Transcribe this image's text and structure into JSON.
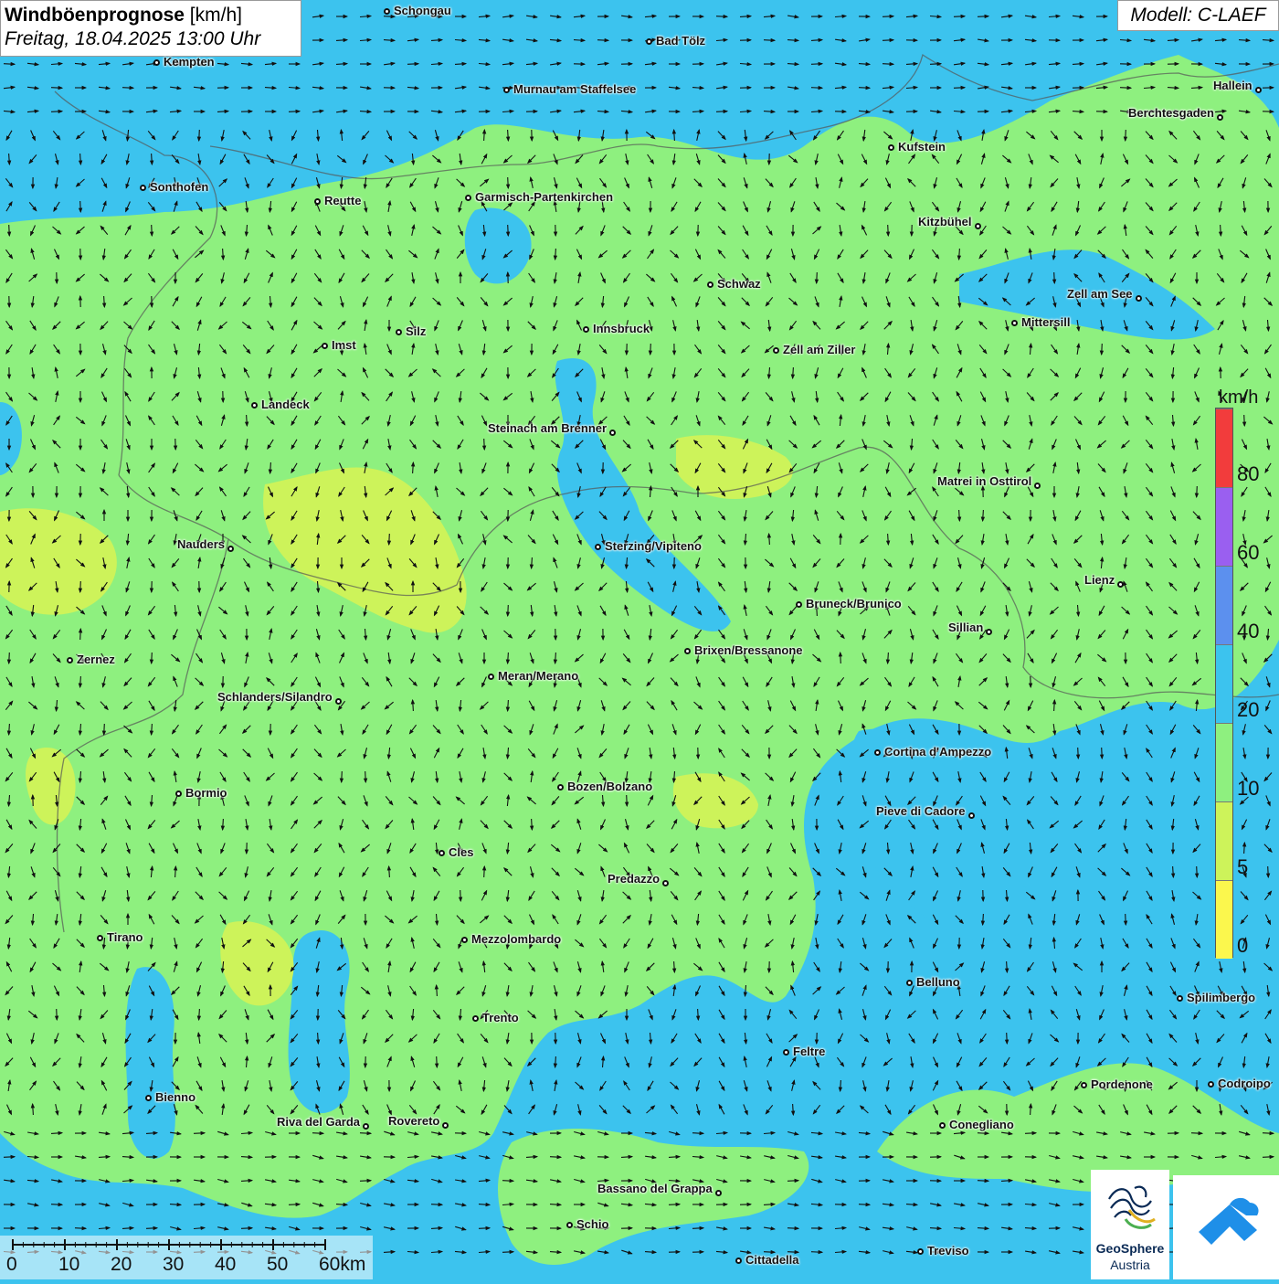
{
  "title": {
    "main_bold": "Windböenprognose",
    "main_unit": " [km/h]",
    "date": "Freitag, 18.04.2025 13:00 Uhr"
  },
  "model": "Modell: C-LAEF",
  "legend": {
    "unit": "km/h",
    "bins": [
      {
        "from": 0,
        "to": 5,
        "color": "#fbf74d"
      },
      {
        "from": 5,
        "to": 10,
        "color": "#cdf35a"
      },
      {
        "from": 10,
        "to": 20,
        "color": "#8ef07f"
      },
      {
        "from": 20,
        "to": 40,
        "color": "#3cc3ee"
      },
      {
        "from": 40,
        "to": 60,
        "color": "#5c90ee"
      },
      {
        "from": 60,
        "to": 80,
        "color": "#9a5ff0"
      },
      {
        "from": 80,
        "to": 100,
        "color": "#f23c3c"
      }
    ],
    "labels": [
      "0",
      "5",
      "10",
      "20",
      "40",
      "60",
      "80"
    ]
  },
  "scalebar": {
    "labels": [
      "0",
      "10",
      "20",
      "30",
      "40",
      "50",
      "60km"
    ]
  },
  "logos": {
    "geosphere_line1": "GeoSphere",
    "geosphere_line2": "Austria"
  },
  "cities": [
    {
      "name": "Schongau",
      "label_side": "right"
    },
    {
      "name": "Bad Tölz",
      "label_side": "right"
    },
    {
      "name": "Kempten",
      "label_side": "right"
    },
    {
      "name": "Murnau am Staffelsee",
      "label_side": "right"
    },
    {
      "name": "Hallein",
      "label_side": "left"
    },
    {
      "name": "Berchtesgaden",
      "label_side": "left"
    },
    {
      "name": "Kufstein",
      "label_side": "right"
    },
    {
      "name": "Sonthofen",
      "label_side": "right"
    },
    {
      "name": "Reutte",
      "label_side": "right"
    },
    {
      "name": "Garmisch-Partenkirchen",
      "label_side": "right"
    },
    {
      "name": "Kitzbühel",
      "label_side": "left"
    },
    {
      "name": "Schwaz",
      "label_side": "right"
    },
    {
      "name": "Zell am See",
      "label_side": "left"
    },
    {
      "name": "Mittersill",
      "label_side": "right"
    },
    {
      "name": "Innsbruck",
      "label_side": "right"
    },
    {
      "name": "Silz",
      "label_side": "right"
    },
    {
      "name": "Imst",
      "label_side": "right"
    },
    {
      "name": "Zell am Ziller",
      "label_side": "right"
    },
    {
      "name": "Landeck",
      "label_side": "right"
    },
    {
      "name": "Steinach am Brenner",
      "label_side": "left"
    },
    {
      "name": "Matrei in Osttirol",
      "label_side": "left"
    },
    {
      "name": "Nauders",
      "label_side": "left"
    },
    {
      "name": "Sterzing/Vipiteno",
      "label_side": "right"
    },
    {
      "name": "Lienz",
      "label_side": "left"
    },
    {
      "name": "Bruneck/Brunico",
      "label_side": "right"
    },
    {
      "name": "Sillian",
      "label_side": "left"
    },
    {
      "name": "Zernez",
      "label_side": "right"
    },
    {
      "name": "Brixen/Bressanone",
      "label_side": "right"
    },
    {
      "name": "Meran/Merano",
      "label_side": "right"
    },
    {
      "name": "Schlanders/Silandro",
      "label_side": "left"
    },
    {
      "name": "Cortina d'Ampezzo",
      "label_side": "right"
    },
    {
      "name": "Bormio",
      "label_side": "right"
    },
    {
      "name": "Bozen/Bolzano",
      "label_side": "right"
    },
    {
      "name": "Pieve di Cadore",
      "label_side": "left"
    },
    {
      "name": "Cles",
      "label_side": "right"
    },
    {
      "name": "Predazzo",
      "label_side": "left"
    },
    {
      "name": "Tirano",
      "label_side": "right"
    },
    {
      "name": "Mezzolombardo",
      "label_side": "right"
    },
    {
      "name": "Belluno",
      "label_side": "right"
    },
    {
      "name": "Spilimbergo",
      "label_side": "right"
    },
    {
      "name": "Trento",
      "label_side": "right"
    },
    {
      "name": "Feltre",
      "label_side": "right"
    },
    {
      "name": "Pordenone",
      "label_side": "right"
    },
    {
      "name": "Codroipo",
      "label_side": "right"
    },
    {
      "name": "Bienno",
      "label_side": "right"
    },
    {
      "name": "Riva del Garda",
      "label_side": "left"
    },
    {
      "name": "Rovereto",
      "label_side": "left"
    },
    {
      "name": "Conegliano",
      "label_side": "right"
    },
    {
      "name": "Bassano del Grappa",
      "label_side": "left"
    },
    {
      "name": "Schio",
      "label_side": "right"
    },
    {
      "name": "Treviso",
      "label_side": "right"
    },
    {
      "name": "Cittadella",
      "label_side": "right"
    }
  ]
}
